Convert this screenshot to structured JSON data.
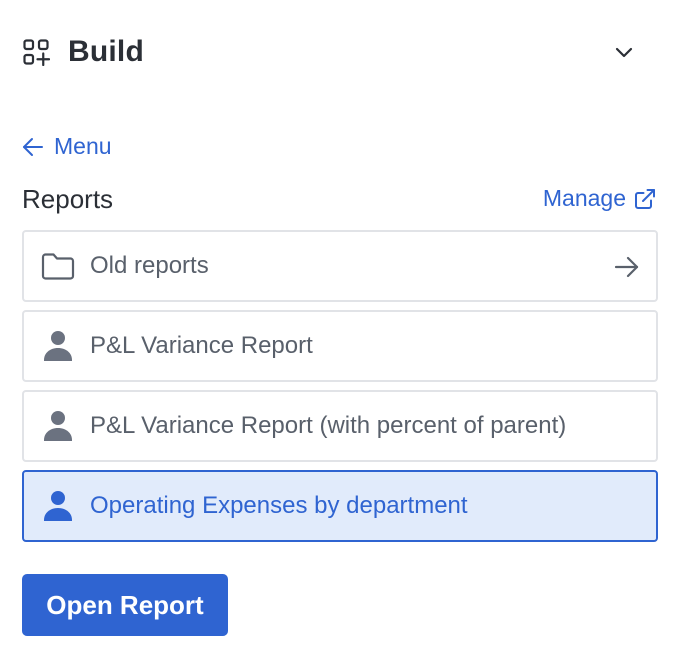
{
  "header": {
    "title": "Build",
    "icon": "apps-grid-plus-icon",
    "collapse_icon": "chevron-down-icon"
  },
  "nav": {
    "back_label": "Menu",
    "back_icon": "arrow-left-icon"
  },
  "section": {
    "title": "Reports",
    "manage_label": "Manage",
    "manage_icon": "external-link-icon"
  },
  "reports": [
    {
      "label": "Old reports",
      "icon": "folder-icon",
      "trailing_icon": "arrow-right-icon",
      "selected": false
    },
    {
      "label": "P&L Variance Report",
      "icon": "person-icon",
      "selected": false
    },
    {
      "label": "P&L Variance Report (with percent of parent)",
      "icon": "person-icon",
      "selected": false
    },
    {
      "label": "Operating Expenses by department",
      "icon": "person-icon",
      "selected": true
    }
  ],
  "actions": {
    "open_label": "Open Report"
  },
  "colors": {
    "accent": "#2f64d1",
    "selected_bg": "#e1ebfb",
    "text_dark": "#2b2f36",
    "text_muted": "#59606b",
    "icon_gray": "#6b7280",
    "border": "#e1e3e7"
  }
}
